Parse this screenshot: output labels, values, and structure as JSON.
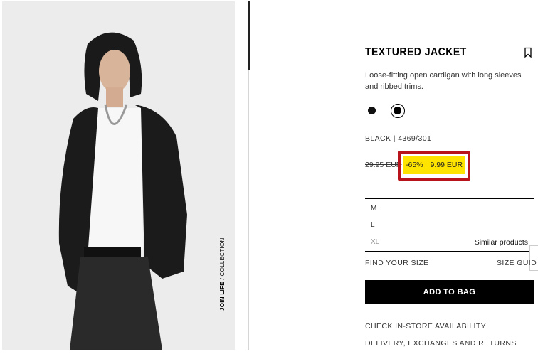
{
  "product": {
    "title": "TEXTURED JACKET",
    "description": "Loose-fitting open cardigan with long sleeves and ribbed trims.",
    "color_code": "BLACK | 4369/301",
    "old_price": "29.95 EUR",
    "discount": "-65%",
    "sale_price": "9.99 EUR",
    "collection_label_bold": "JOIN LIFE",
    "collection_label_rest": " / COLLECTION"
  },
  "colors": {
    "highlight": "#ffe400",
    "highlight_border": "#b8121b"
  },
  "sizes": {
    "items": [
      "M",
      "L",
      "XL"
    ],
    "similar_label": "Similar products"
  },
  "actions": {
    "find_size": "FIND YOUR SIZE",
    "size_guide": "SIZE GUID",
    "add_to_bag": "ADD TO BAG",
    "check_store": "CHECK IN-STORE AVAILABILITY",
    "delivery": "DELIVERY, EXCHANGES AND RETURNS"
  }
}
